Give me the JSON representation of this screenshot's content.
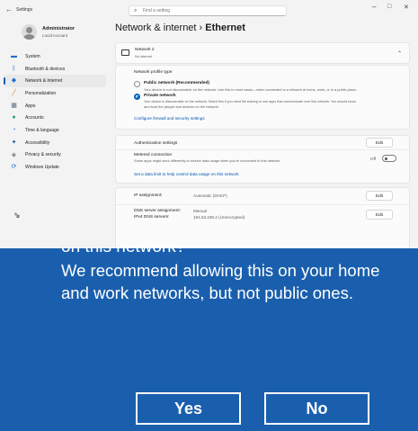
{
  "titlebar": {
    "app_title": "Settings",
    "search_placeholder": "Find a setting",
    "minimize": "–",
    "maximize": "□",
    "close": "✕"
  },
  "profile": {
    "name": "Administrator",
    "account_type": "Local Account"
  },
  "nav": {
    "items": [
      {
        "label": "System",
        "icon": "monitor-icon",
        "color": "#1f6fcf",
        "active": false
      },
      {
        "label": "Bluetooth & devices",
        "icon": "bluetooth-icon",
        "color": "#1f6fcf",
        "active": false
      },
      {
        "label": "Network & internet",
        "icon": "wifi-icon",
        "color": "#1f6fcf",
        "active": true
      },
      {
        "label": "Personalization",
        "icon": "brush-icon",
        "color": "#d9822b",
        "active": false
      },
      {
        "label": "Apps",
        "icon": "apps-icon",
        "color": "#5a6b7d",
        "active": false
      },
      {
        "label": "Accounts",
        "icon": "person-icon",
        "color": "#2e9e6a",
        "active": false
      },
      {
        "label": "Time & language",
        "icon": "globe-clock-icon",
        "color": "#1f6fcf",
        "active": false
      },
      {
        "label": "Accessibility",
        "icon": "accessibility-icon",
        "color": "#1f4fa8",
        "active": false
      },
      {
        "label": "Privacy & security",
        "icon": "shield-icon",
        "color": "#6b7785",
        "active": false
      },
      {
        "label": "Windows Update",
        "icon": "update-icon",
        "color": "#1f6fcf",
        "active": false
      }
    ]
  },
  "breadcrumb": {
    "parent": "Network & internet",
    "separator": "›",
    "current": "Ethernet"
  },
  "network_card": {
    "name": "Network 2",
    "status": "No internet",
    "chevron": "⌃"
  },
  "profile_type": {
    "heading": "Network profile type",
    "public_label": "Public network (Recommended)",
    "public_desc": "Your device is not discoverable on the network. Use this in most cases—when connected to a network at home, work, or in a public place.",
    "private_label": "Private network",
    "private_desc_1": "Your device is discoverable on the network. Select this if you need file sharing or use apps that communicate over this network. You should know",
    "private_desc_2": "and trust the people and devices on the network.",
    "selected": "private",
    "firewall_link": "Configure firewall and security settings"
  },
  "auth": {
    "label": "Authentication settings",
    "edit": "Edit"
  },
  "metered": {
    "label": "Metered connection",
    "desc": "Some apps might work differently to reduce data usage when you're connected to this network",
    "state": "Off",
    "link": "Set a data limit to help control data usage on this network"
  },
  "ip": {
    "label": "IP assignment:",
    "value": "Automatic (DHCP)",
    "edit": "Edit"
  },
  "dns": {
    "label": "DNS server assignment:",
    "value": "Manual",
    "ipv4_label": "IPv4 DNS servers:",
    "ipv4_value": "194.63.239.4 (Unencrypted)",
    "edit": "Edit"
  },
  "overlay": {
    "partial_text": "on this network?",
    "message": "We recommend allowing this on your home and work networks, but not public ones.",
    "yes": "Yes",
    "no": "No",
    "background": "#1a5fad"
  }
}
